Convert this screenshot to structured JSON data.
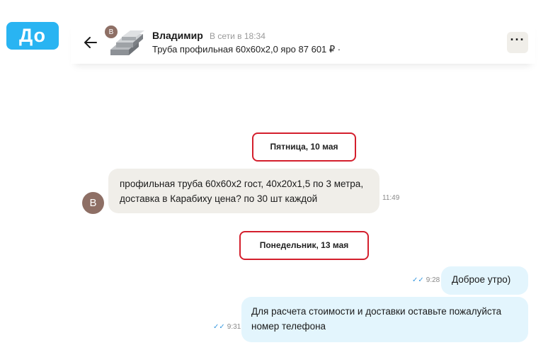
{
  "corner_badge": "До",
  "header": {
    "avatar_letter": "В",
    "name": "Владимир",
    "status": "В сети в 18:34",
    "product": "Труба профильная 60х60х2,0 яро 87 601 ₽ ·",
    "more_label": "···"
  },
  "messages": [
    {
      "type": "date",
      "text": "Пятница, 10 мая"
    },
    {
      "type": "incoming",
      "avatar": "В",
      "text": "профильная труба 60х60х2 гост, 40х20х1,5 по 3 метра, доставка в Карабиху цена? по 30 шт каждой",
      "time": "11:49"
    },
    {
      "type": "date",
      "text": "Понедельник, 13 мая"
    },
    {
      "type": "outgoing",
      "text": "Доброе утро)",
      "time": "9:28",
      "ticks": "✓✓"
    },
    {
      "type": "outgoing",
      "text": "Для расчета стоимости и доставки оставьте пожалуйста номер телефона",
      "time": "9:31",
      "ticks": "✓✓"
    }
  ],
  "colors": {
    "badge": "#29b4f2",
    "incoming_bubble": "#f0eee9",
    "outgoing_bubble": "#e3f5fd",
    "date_highlight": "#d41f2d",
    "avatar": "#8e6f65",
    "read_ticks": "#3a9ae0"
  },
  "icons": {
    "back": "arrow-left-icon",
    "more": "more-dots-icon",
    "read": "double-check-icon"
  }
}
